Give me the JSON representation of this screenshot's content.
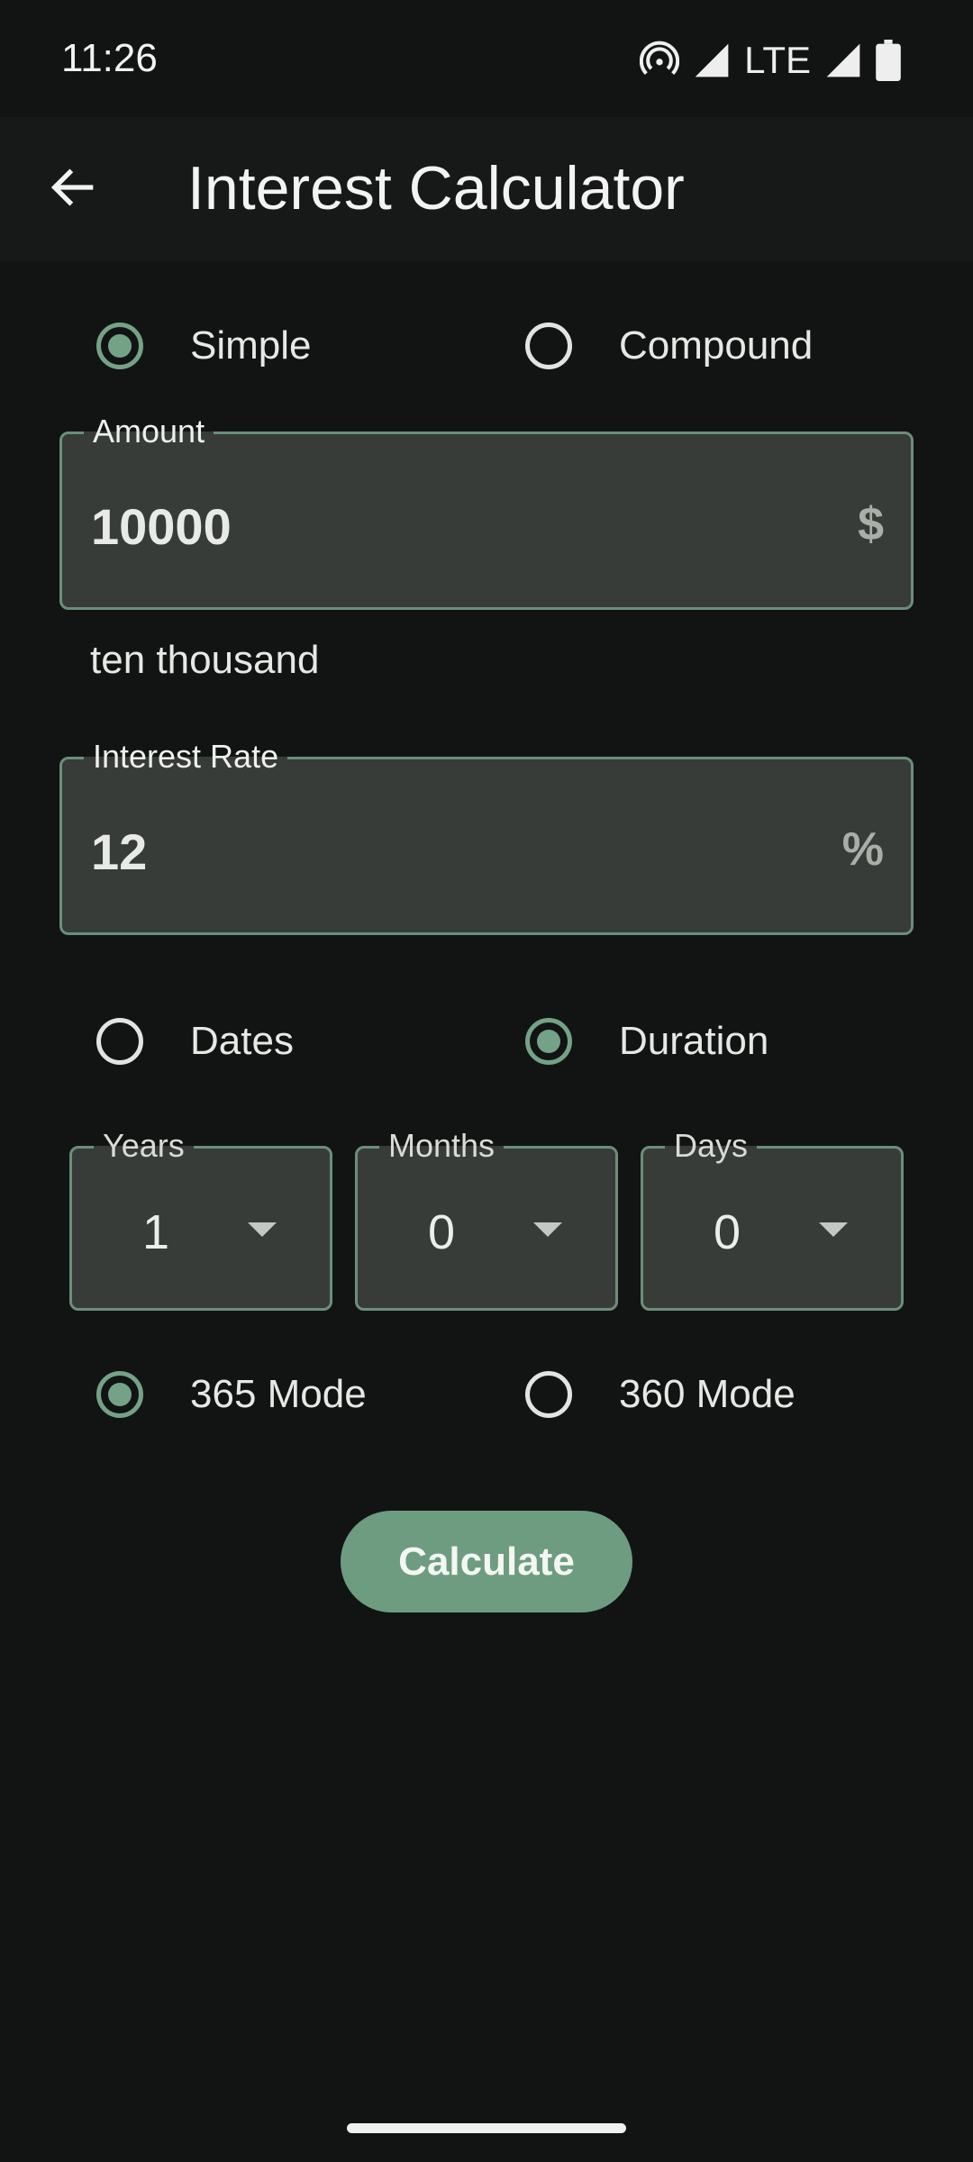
{
  "status_bar": {
    "time": "11:26",
    "network": "LTE",
    "icons": [
      "hotspot-icon",
      "signal-icon",
      "signal-icon",
      "battery-icon"
    ]
  },
  "app_bar": {
    "title": "Interest Calculator",
    "back_icon": "arrow-back-icon"
  },
  "interest_type": {
    "options": [
      "Simple",
      "Compound"
    ],
    "selected": "Simple"
  },
  "amount": {
    "label": "Amount",
    "value": "10000",
    "suffix": "$",
    "in_words": "ten thousand"
  },
  "rate": {
    "label": "Interest Rate",
    "value": "12",
    "suffix": "%"
  },
  "period_type": {
    "options": [
      "Dates",
      "Duration"
    ],
    "selected": "Duration"
  },
  "duration": {
    "years": {
      "label": "Years",
      "value": "1"
    },
    "months": {
      "label": "Months",
      "value": "0"
    },
    "days": {
      "label": "Days",
      "value": "0"
    }
  },
  "day_mode": {
    "options": [
      "365 Mode",
      "360 Mode"
    ],
    "selected": "365 Mode"
  },
  "calculate_label": "Calculate",
  "colors": {
    "background": "#121413",
    "accent": "#74a287",
    "field": "#373c38",
    "button": "#6d9c81"
  }
}
